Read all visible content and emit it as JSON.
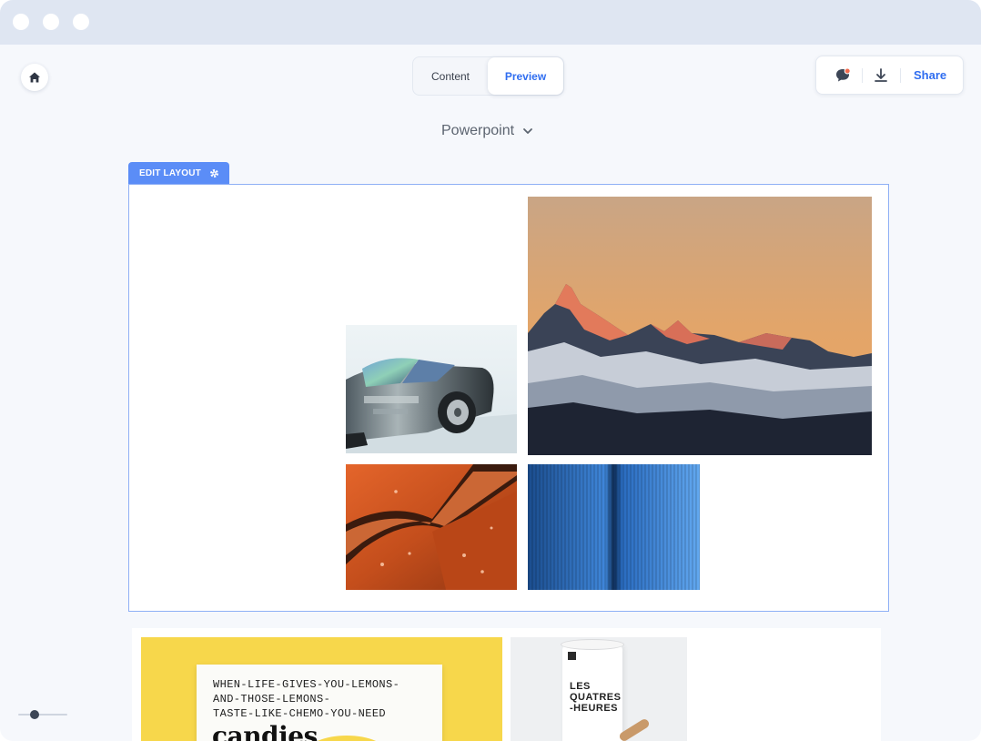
{
  "window": {
    "controls": [
      "close",
      "minimize",
      "maximize"
    ]
  },
  "toolbar": {
    "home_icon": "home-icon",
    "tabs": [
      {
        "label": "Content",
        "active": false
      },
      {
        "label": "Preview",
        "active": true
      }
    ],
    "actions": {
      "comment_icon": "comment-icon",
      "download_icon": "download-icon",
      "share_label": "Share"
    }
  },
  "format_select": {
    "value": "Powerpoint",
    "icon": "chevron-down-icon"
  },
  "slide": {
    "edit_layout_label": "EDIT LAYOUT",
    "edit_layout_icon": "gear-icon",
    "images": [
      "car-photo",
      "mountain-photo",
      "orange-surface-photo",
      "blue-pleats-photo"
    ]
  },
  "next_slide": {
    "poster_lines": [
      "WHEN-LIFE-GIVES-YOU-LEMONS-",
      "AND-THOSE-LEMONS-",
      "TASTE-LIKE-CHEMO-YOU-NEED"
    ],
    "poster_big": "candies",
    "cup_lines": [
      "LES",
      "QUATRES",
      "-HEURES"
    ]
  },
  "zoom": {
    "level": 0.3
  },
  "colors": {
    "accent": "#2f6df0",
    "edit_tag": "#5b8df7",
    "slide_border": "#8fb0f5"
  }
}
